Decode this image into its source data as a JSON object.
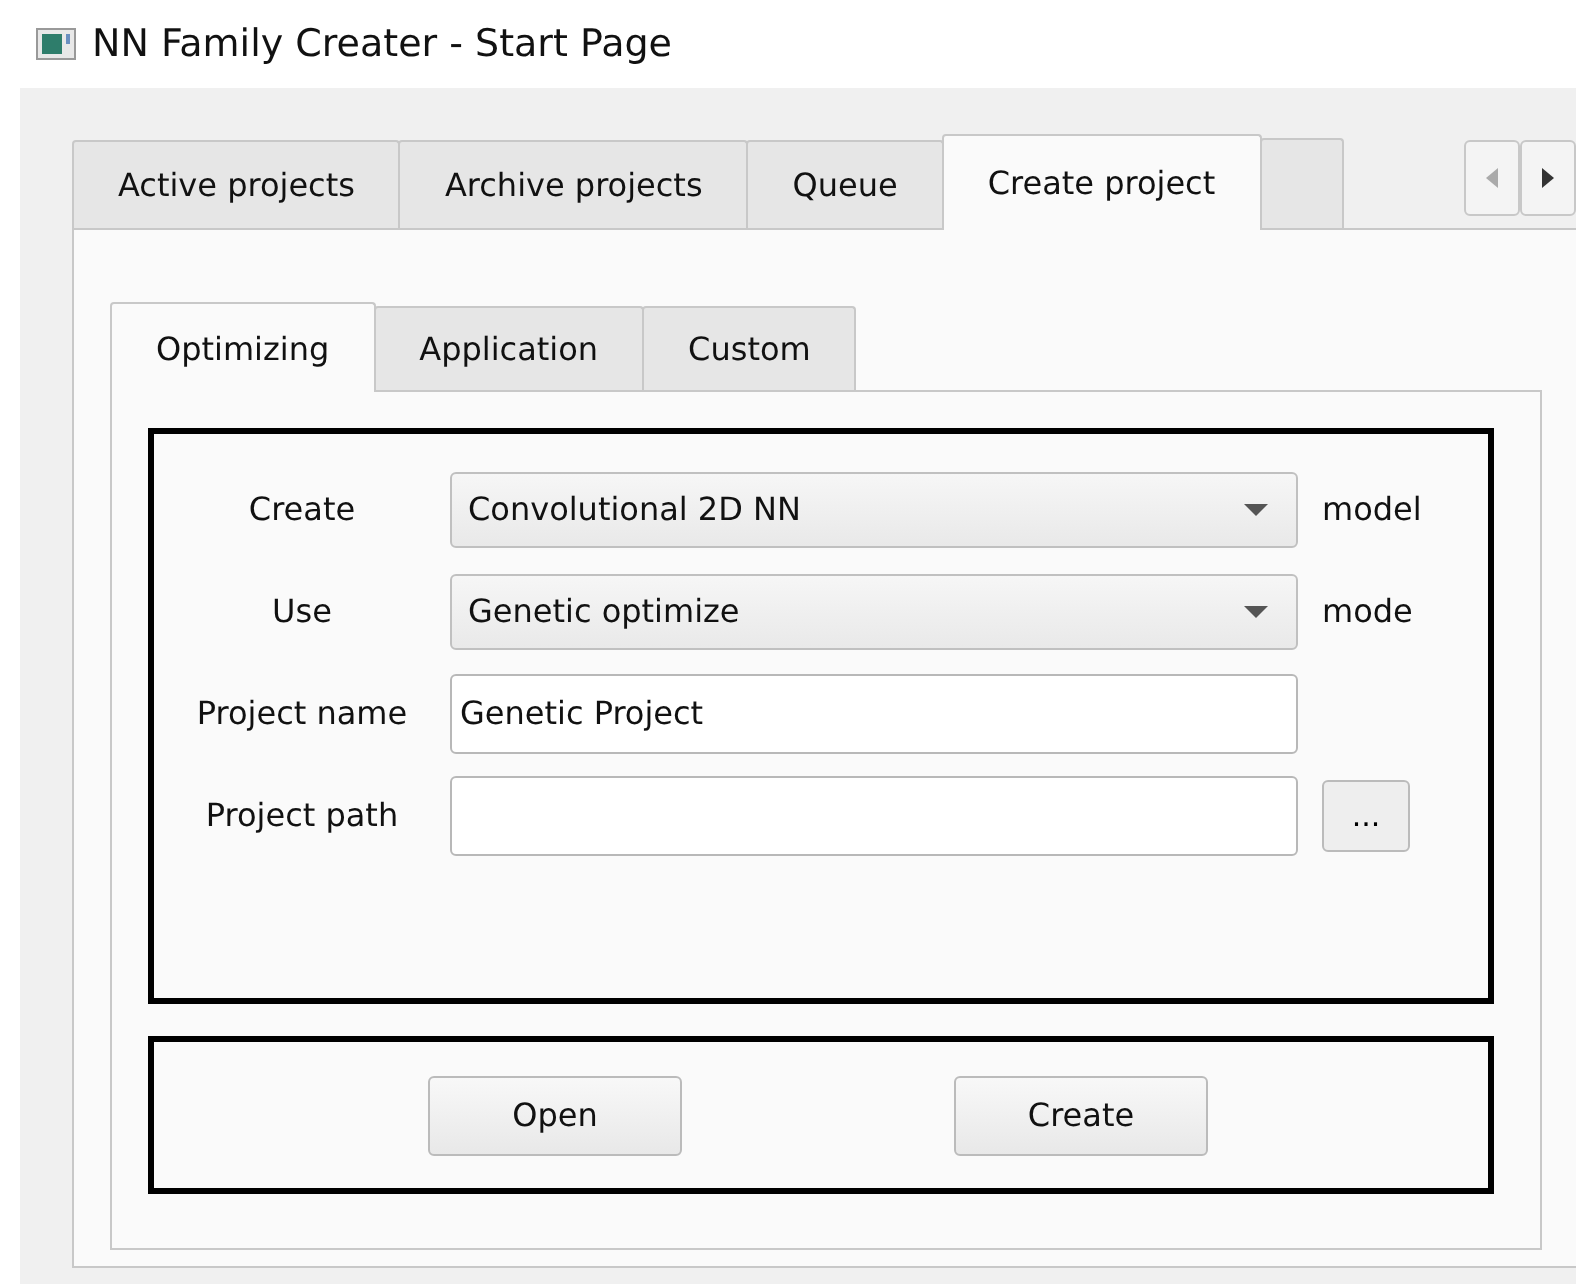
{
  "window": {
    "title": "NN Family Creater - Start Page"
  },
  "tabs": [
    {
      "label": "Active projects",
      "selected": false
    },
    {
      "label": "Archive projects",
      "selected": false
    },
    {
      "label": "Queue",
      "selected": false
    },
    {
      "label": "Create project",
      "selected": true
    }
  ],
  "subtabs": [
    {
      "label": "Optimizing",
      "selected": true
    },
    {
      "label": "Application",
      "selected": false
    },
    {
      "label": "Custom",
      "selected": false
    }
  ],
  "form": [
    {
      "kind": "combo",
      "label": "Create",
      "value": "Convolutional 2D NN",
      "suffix": "model"
    },
    {
      "kind": "combo",
      "label": "Use",
      "value": "Genetic optimize",
      "suffix": "mode"
    },
    {
      "kind": "text",
      "label": "Project name",
      "value": "Genetic Project"
    },
    {
      "kind": "browse",
      "label": "Project path",
      "button": "..."
    }
  ],
  "buttons": [
    "Open",
    "Create"
  ]
}
